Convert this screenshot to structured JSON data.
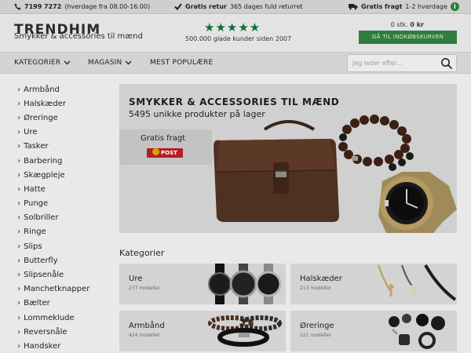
{
  "topbar": {
    "phone": "7199 7272",
    "hours": "(hverdage fra 08.00-16.00)",
    "return_bold": "Gratis retur",
    "return_text": "365 dages fuld returret",
    "shipping_bold": "Gratis fragt",
    "shipping_text": "1-2 hverdage",
    "info": "i"
  },
  "header": {
    "logo": "TRENDHIM",
    "tagline": "Smykker & accessories til mænd",
    "stars": "★★★★★",
    "reviews": "500.000 glade kunder siden 2007",
    "cart_count": "0 stk.",
    "cart_total": "0 kr",
    "cart_button": "GÅ TIL INDKØBSKURVEN"
  },
  "nav": {
    "items": [
      "KATEGORIER",
      "MAGASIN",
      "MEST POPULÆRE"
    ],
    "search_placeholder": "Jeg leder efter..."
  },
  "sidebar": {
    "items": [
      "Armbånd",
      "Halskæder",
      "Øreringe",
      "Ure",
      "Tasker",
      "Barbering",
      "Skægpleje",
      "Hatte",
      "Punge",
      "Solbriller",
      "Ringe",
      "Slips",
      "Butterfly",
      "Slipsenåle",
      "Manchetknapper",
      "Bælter",
      "Lommeklude",
      "Reversnåle",
      "Handsker"
    ]
  },
  "hero": {
    "title": "SMYKKER & ACCESSORIES TIL MÆND",
    "subtitle": "5495 unikke produkter på lager",
    "shipping": "Gratis fragt",
    "post_label": "POST"
  },
  "categories": {
    "heading": "Kategorier",
    "cards": [
      {
        "name": "Ure",
        "count": "277 modeller"
      },
      {
        "name": "Halskæder",
        "count": "213 modeller"
      },
      {
        "name": "Armbånd",
        "count": "424 modeller"
      },
      {
        "name": "Øreringe",
        "count": "221 modeller"
      }
    ]
  },
  "colors": {
    "accent_green": "#2f7d3e",
    "post_red": "#b51f23"
  }
}
